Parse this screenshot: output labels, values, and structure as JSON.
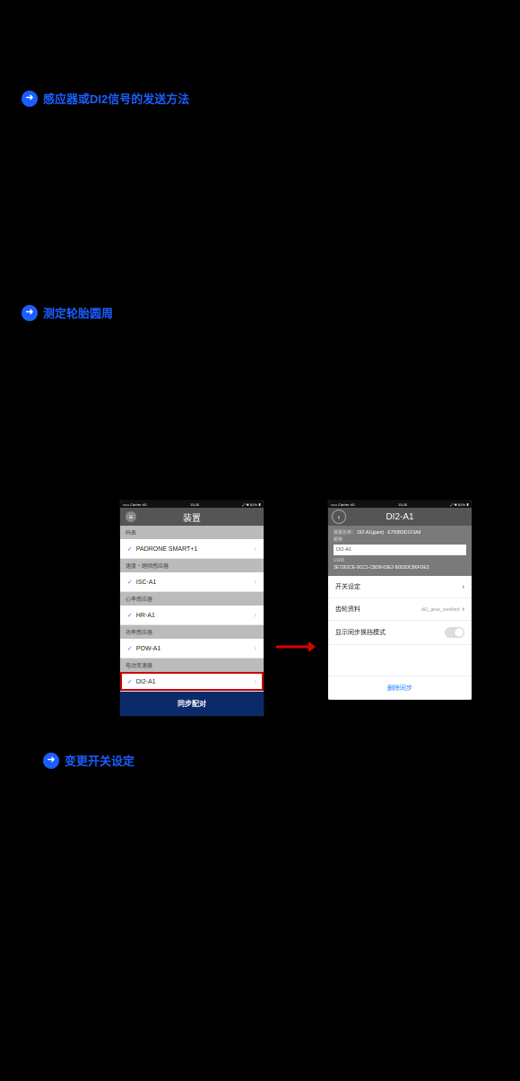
{
  "links": {
    "link1": "感应器或DI2信号的发送方法",
    "link2": "测定轮胎圆周",
    "link3": "变更开关设定"
  },
  "statusbar": {
    "left": "••••• Carrier   4G",
    "time": "15:26",
    "right": "⤢ ✱ 81% ▮"
  },
  "left_phone": {
    "title": "装置",
    "sections": {
      "s1": "码表",
      "s1_item": "PADRONE SMART+1",
      "s2": "速度・踏频感应器",
      "s2_item": "ISC-A1",
      "s3": "心率感应器",
      "s3_item": "HR-A1",
      "s4": "功率感应器",
      "s4_item": "POW-A1",
      "s5": "电动变速器",
      "s5_item": "DI2-A1"
    },
    "bottom": "同步配对"
  },
  "right_phone": {
    "title": "DI2-A1",
    "device_name_label": "装置名称：",
    "device_name": "DI2-A1(giant)",
    "serial": "E700BDD1F3A8",
    "nick_label": "昵称",
    "nick_value": "DI2-A1",
    "uuid_label": "UUID",
    "uuid_value": "3E7262CE-9CC1-CBD8-03E2-B053DCB6FDE3",
    "row1": "开关设定",
    "row2": "齿轮资料",
    "row2_sub": "di2_gear_toothed",
    "row3": "显示同步换挡模式",
    "delete": "删除同步"
  }
}
